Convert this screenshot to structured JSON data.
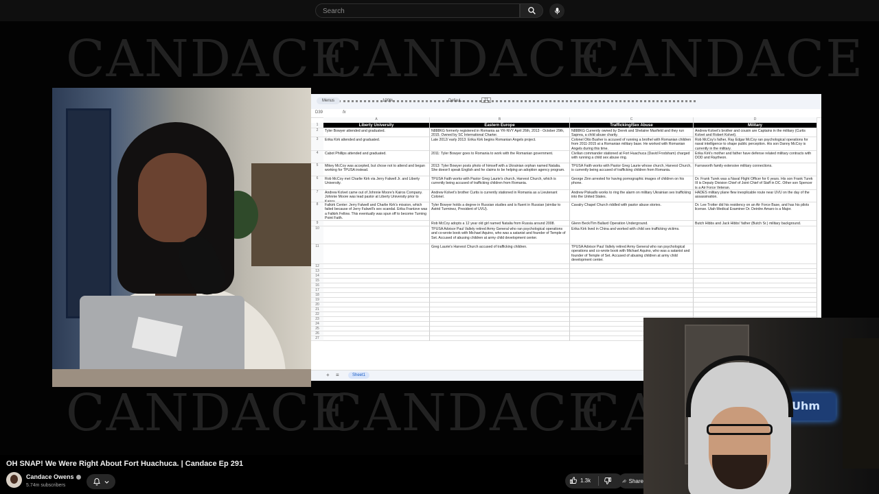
{
  "search": {
    "placeholder": "Search"
  },
  "video": {
    "watermark": "CANDACE",
    "spreadsheet": {
      "toolbar": {
        "menus": "Menus",
        "zoom": "100%",
        "font": "Defaul...",
        "font_size": "11"
      },
      "name_box": "D39",
      "fx": "fx",
      "columns": [
        "A",
        "B",
        "C",
        "D"
      ],
      "headers": [
        "Liberty University",
        "Eastern Europe",
        "Trafficking/Sex Abuse",
        "Military"
      ],
      "rows": [
        [
          "Tyler Bowyer attended and graduated.",
          "N888KG formerly registered in Romania as YR-NVY April 26th, 2013 - October 29th, 2015. Owned by SC International Charter.",
          "N888KG Currently owned by Derek and Shelaine Maxfield and they run Saprea, a child abuse charity.",
          "Andrew Kolvet's brother and cousin are Captains in the military (Curtis Kolvet and Robert Kolvet)."
        ],
        [
          "Erika Kirk attended and graduated.",
          "Late 2012/ early 2013: Erika Kirk begins Romanian Angels project.",
          "Colonel Otto Busher is accused of running a brothel with Romanian children from 2011-2015 at a Romanian military base. He worked with Romanian Angels during this time.",
          "Rob McCoy's father, Ray Edgar McCoy ran psychological operations for naval intelligence to shape public perception. His son Danny McCoy is currently in the military."
        ],
        [
          "Cabot Phillips attended and graduated.",
          "2011: Tyler Bowyer goes to Romania to work with the Romanian government.",
          "Civilian commander stationed at Fort Huachuca (David Frodsham) charged with running a child sex abuse ring.",
          "Erika Kirk's mother and father have defense related military contracts with DOD and Raytheon."
        ],
        [
          "Mikey McCoy was accepted, but chose not to attend and began working for TPUSA instead.",
          "2013: Tyler Bowyer posts photo of himself with a Ukrainian orphan named Natalia. She doesn't speak English and he claims to be helping an adoption agency program.",
          "TPUSA Faith works with Pastor Greg Laurie whose church, Harvest Church, is currently being accused of trafficking children from Romania.",
          "Farnsworth family extensive military connections."
        ],
        [
          "Rob McCoy met Charlie Kirk via Jerry Falwell Jr. and Liberty University.",
          "TPUSA Faith works with Pastor Greg Laurie's church, Harvest Church, which is currently being accused of trafficking children from Romania.",
          "George Zinn arrested for having pornographic images of children on his phone.",
          "Dr. Frank Turek was a Naval Flight Officer for 6 years. His son Frank Turek III is Deputy Division Chief of Joint Chief of Staff in DC. Other son Spencer is a Air Force Veteran."
        ],
        [
          "Andrew Kolvet came out of Johnnie Moore's Kairos Company. Johnnie Moore was lead pastor at Liberty University prior to Kairos.",
          "Andrew Kolvet's brother Curtis is currently stationed in Romania as a Lieutenant Colonel.",
          "Andrew Piskadlo works to ring the alarm on military Ukrainian sex trafficking into the United States.",
          "HADES military plane flew inexplicable route near UVU on the day of the assassination."
        ],
        [
          "Falkirk Center: Jerry Falwell and Charlie Kirk's mission, which failed because of Jerry Falwell's sex scandal. Erika Frantzve was a Falkirk Fellow. This eventually was spun off to become Turning Point Faith.",
          "Tyler Bowyer holds a degree in Russian studies and is fluent in Russian (similar to Astrid Turminez, President of UVU).",
          "Cavalry Chapel Church riddled with pastor abuse stories.",
          "Dr. Lee Trotter did his residency on an Air Force Base, and has his pilots license. Utah Medical Examiner Dr. Deirdre Amaro is a Major."
        ],
        [
          "",
          "Rob McCoy adopts a 12 year old girl named Natalia from Russia around 2008.",
          "Glenn Beck/Tim Ballard Operation Underground.",
          "Butch Hibbs and Jack Hibbs' father (Butch Sr.) military background."
        ],
        [
          "",
          "TPUSA Advisor Paul Vallely retired Army General who ran psychological operations and co-wrote book with Michael Aquino, who was a satanist and founder of Temple of Set. Accused of abusing children at army child development center.",
          "Erika Kirk lived in China and worked with child sex trafficking victims.",
          ""
        ],
        [
          "",
          "Greg Laurie's Harvest Church accused of trafficking children.",
          "TPUSA Advisor Paul Vallely retired Army General who ran psychological operations and co-wrote book with Michael Aquino, who was a satanist and founder of Temple of Set. Accused of abusing children at army child development center.",
          ""
        ]
      ],
      "row_numbers": [
        "1",
        "2",
        "3",
        "4",
        "5",
        "6",
        "7",
        "8",
        "9",
        "10",
        "11",
        "12",
        "13",
        "14",
        "15",
        "16",
        "17",
        "18",
        "19",
        "20",
        "21",
        "22",
        "23",
        "24",
        "25",
        "26",
        "27"
      ],
      "sheet_tab": "Sheet1",
      "add_sheet": "+",
      "sheet_list": "≡"
    },
    "overlay_text": "Uhm"
  },
  "info": {
    "title": "OH SNAP! We Were Right About Fort Huachuca. | Candace Ep 291",
    "channel": "Candace Owens",
    "subscribers": "5.74m subscribers",
    "likes": "1.3k",
    "share": "Share"
  },
  "colors": {
    "background": "#000000",
    "topbar": "#0f0f0f",
    "button": "#272727",
    "header_fill": "#000000"
  }
}
